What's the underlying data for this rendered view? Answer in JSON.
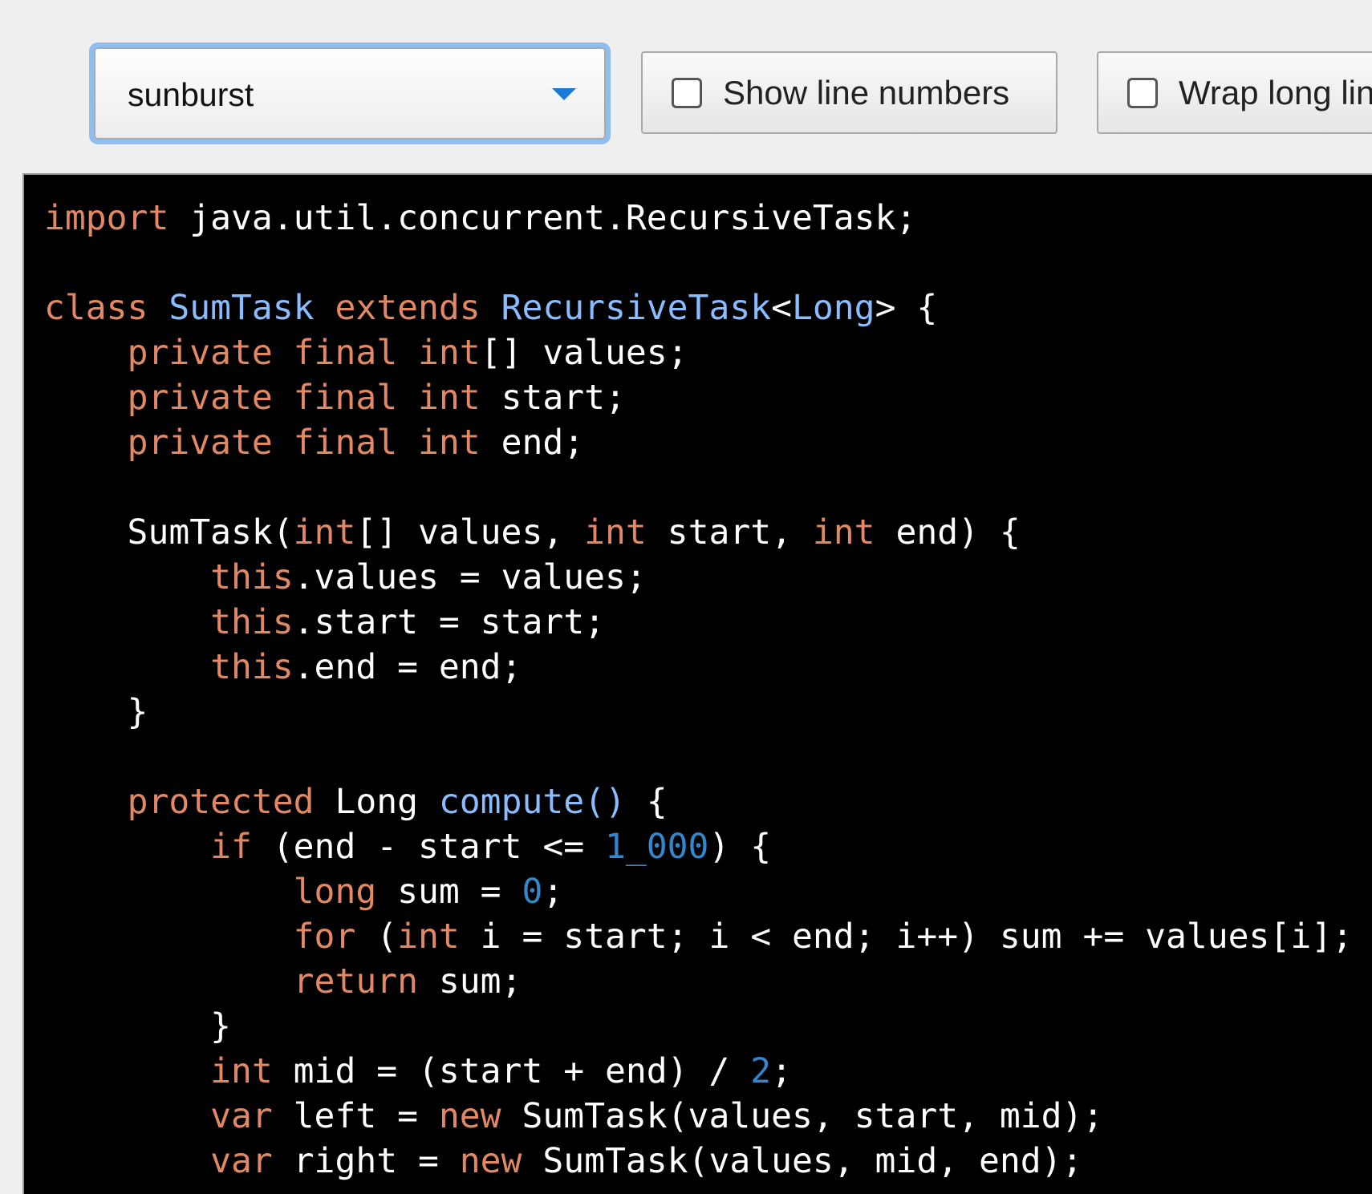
{
  "toolbar": {
    "theme_select": {
      "selected": "sunburst",
      "arrow_icon": "dropdown-arrow-icon"
    },
    "line_numbers": {
      "label": "Show line numbers",
      "checked": false
    },
    "wrap": {
      "label": "Wrap long lin",
      "checked": false
    }
  },
  "colors": {
    "keyword": "#e28964",
    "type": "#89bdff",
    "number": "#3387cc",
    "plain": "#ffffff",
    "background": "#000000",
    "focus_ring": "#8ebdf0"
  },
  "code_lines": [
    [
      [
        "k",
        "import"
      ],
      [
        "p",
        " java.util.concurrent.RecursiveTask;"
      ]
    ],
    [],
    [
      [
        "k",
        "class"
      ],
      [
        "p",
        " "
      ],
      [
        "t",
        "SumTask"
      ],
      [
        "p",
        " "
      ],
      [
        "k",
        "extends"
      ],
      [
        "p",
        " "
      ],
      [
        "t",
        "RecursiveTask"
      ],
      [
        "p",
        "<"
      ],
      [
        "t",
        "Long"
      ],
      [
        "p",
        "> {"
      ]
    ],
    [
      [
        "p",
        "    "
      ],
      [
        "k",
        "private"
      ],
      [
        "p",
        " "
      ],
      [
        "k",
        "final"
      ],
      [
        "p",
        " "
      ],
      [
        "k",
        "int"
      ],
      [
        "p",
        "[] values;"
      ]
    ],
    [
      [
        "p",
        "    "
      ],
      [
        "k",
        "private"
      ],
      [
        "p",
        " "
      ],
      [
        "k",
        "final"
      ],
      [
        "p",
        " "
      ],
      [
        "k",
        "int"
      ],
      [
        "p",
        " start;"
      ]
    ],
    [
      [
        "p",
        "    "
      ],
      [
        "k",
        "private"
      ],
      [
        "p",
        " "
      ],
      [
        "k",
        "final"
      ],
      [
        "p",
        " "
      ],
      [
        "k",
        "int"
      ],
      [
        "p",
        " end;"
      ]
    ],
    [],
    [
      [
        "p",
        "    SumTask("
      ],
      [
        "k",
        "int"
      ],
      [
        "p",
        "[] values, "
      ],
      [
        "k",
        "int"
      ],
      [
        "p",
        " start, "
      ],
      [
        "k",
        "int"
      ],
      [
        "p",
        " end) {"
      ]
    ],
    [
      [
        "p",
        "        "
      ],
      [
        "k",
        "this"
      ],
      [
        "p",
        ".values = values;"
      ]
    ],
    [
      [
        "p",
        "        "
      ],
      [
        "k",
        "this"
      ],
      [
        "p",
        ".start = start;"
      ]
    ],
    [
      [
        "p",
        "        "
      ],
      [
        "k",
        "this"
      ],
      [
        "p",
        ".end = end;"
      ]
    ],
    [
      [
        "p",
        "    }"
      ]
    ],
    [],
    [
      [
        "p",
        "    "
      ],
      [
        "k",
        "protected"
      ],
      [
        "p",
        " Long "
      ],
      [
        "t",
        "compute()"
      ],
      [
        "p",
        " {"
      ]
    ],
    [
      [
        "p",
        "        "
      ],
      [
        "k",
        "if"
      ],
      [
        "p",
        " (end - start <= "
      ],
      [
        "n",
        "1_000"
      ],
      [
        "p",
        ") {"
      ]
    ],
    [
      [
        "p",
        "            "
      ],
      [
        "k",
        "long"
      ],
      [
        "p",
        " sum = "
      ],
      [
        "n",
        "0"
      ],
      [
        "p",
        ";"
      ]
    ],
    [
      [
        "p",
        "            "
      ],
      [
        "k",
        "for"
      ],
      [
        "p",
        " ("
      ],
      [
        "k",
        "int"
      ],
      [
        "p",
        " i = start; i < end; i++) sum += values[i];"
      ]
    ],
    [
      [
        "p",
        "            "
      ],
      [
        "k",
        "return"
      ],
      [
        "p",
        " sum;"
      ]
    ],
    [
      [
        "p",
        "        }"
      ]
    ],
    [
      [
        "p",
        "        "
      ],
      [
        "k",
        "int"
      ],
      [
        "p",
        " mid = (start + end) / "
      ],
      [
        "n",
        "2"
      ],
      [
        "p",
        ";"
      ]
    ],
    [
      [
        "p",
        "        "
      ],
      [
        "k",
        "var"
      ],
      [
        "p",
        " left = "
      ],
      [
        "k",
        "new"
      ],
      [
        "p",
        " SumTask(values, start, mid);"
      ]
    ],
    [
      [
        "p",
        "        "
      ],
      [
        "k",
        "var"
      ],
      [
        "p",
        " right = "
      ],
      [
        "k",
        "new"
      ],
      [
        "p",
        " SumTask(values, mid, end);"
      ]
    ]
  ]
}
